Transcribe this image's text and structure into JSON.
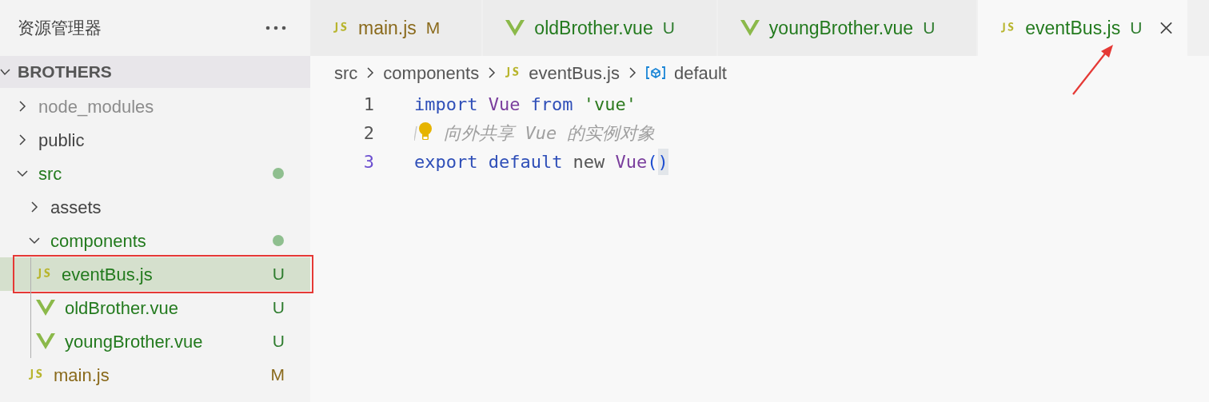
{
  "explorer": {
    "title": "资源管理器",
    "root": {
      "label": "BROTHERS",
      "expanded": true
    },
    "tree": [
      {
        "kind": "folder",
        "label": "node_modules",
        "expanded": false,
        "ignored": true,
        "selected": false
      },
      {
        "kind": "folder",
        "label": "public",
        "expanded": false,
        "ignored": false,
        "selected": false
      },
      {
        "kind": "folder",
        "label": "src",
        "expanded": true,
        "ignored": false,
        "selected": false,
        "has_changes": true,
        "children": [
          {
            "kind": "folder",
            "label": "assets",
            "expanded": false,
            "ignored": false,
            "selected": false
          },
          {
            "kind": "folder",
            "label": "components",
            "expanded": true,
            "ignored": false,
            "selected": false,
            "has_changes": true,
            "children": [
              {
                "kind": "js",
                "label": "eventBus.js",
                "selected": true,
                "status": "U",
                "annotated": true
              },
              {
                "kind": "vue",
                "label": "oldBrother.vue",
                "selected": false,
                "status": "U",
                "annotated": false
              },
              {
                "kind": "vue",
                "label": "youngBrother.vue",
                "selected": false,
                "status": "U",
                "annotated": false
              }
            ]
          },
          {
            "kind": "js",
            "label": "main.js",
            "selected": false,
            "status": "M",
            "annotated": false
          }
        ]
      }
    ]
  },
  "tabs": [
    {
      "kind": "js",
      "label": "main.js",
      "status": "M",
      "selected": false,
      "annotated": false
    },
    {
      "kind": "vue",
      "label": "oldBrother.vue",
      "status": "U",
      "selected": false,
      "annotated": false
    },
    {
      "kind": "vue",
      "label": "youngBrother.vue",
      "status": "U",
      "selected": false,
      "annotated": false
    },
    {
      "kind": "js",
      "label": "eventBus.js",
      "status": "U",
      "selected": true,
      "annotated": true
    }
  ],
  "breadcrumb": [
    {
      "kind": "folder",
      "label": "src"
    },
    {
      "kind": "folder",
      "label": "components"
    },
    {
      "kind": "js",
      "label": "eventBus.js"
    },
    {
      "kind": "symbol",
      "label": "default"
    }
  ],
  "code": [
    {
      "number": "1",
      "active": false,
      "tokens": [
        {
          "kind": "keyword",
          "text": "import"
        },
        {
          "kind": "class",
          "text": "Vue"
        },
        {
          "kind": "keyword",
          "text": "from"
        },
        {
          "kind": "string",
          "text": "'vue'"
        }
      ]
    },
    {
      "number": "2",
      "active": false,
      "lightbulb": true,
      "tokens": [
        {
          "kind": "comment",
          "text": " 向外共享 Vue 的实例对象"
        }
      ]
    },
    {
      "number": "3",
      "active": true,
      "tokens": [
        {
          "kind": "keyword",
          "text": "export"
        },
        {
          "kind": "keyword",
          "text": "default"
        },
        {
          "kind": "operator",
          "text": "new"
        },
        {
          "kind": "class",
          "text": "Vue"
        },
        {
          "kind": "bracket",
          "text": "(",
          "joined": true
        },
        {
          "kind": "bracket-match",
          "text": ")",
          "joined": true
        }
      ]
    }
  ]
}
